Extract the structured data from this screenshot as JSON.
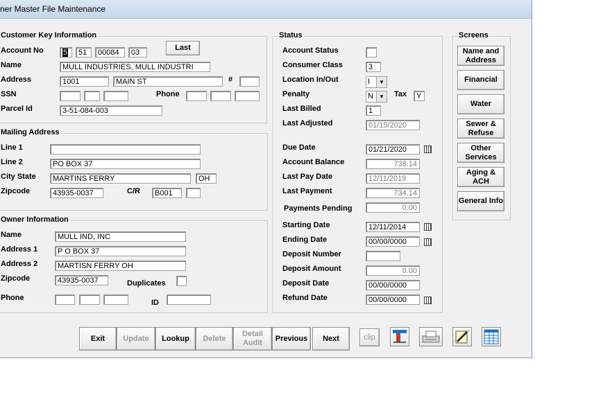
{
  "window": {
    "title": "ner Master File Maintenance"
  },
  "key_info": {
    "legend": "Customer Key Information",
    "account_no_label": "Account No",
    "account_no": [
      "5",
      "51",
      "00084",
      "03"
    ],
    "last_button": "Last",
    "name_label": "Name",
    "name": "MULL INDUSTRIES, MULL INDUSTRI",
    "address_label": "Address",
    "address_number": "1001",
    "address_street": "MAIN ST",
    "unit_label": "#",
    "unit": "",
    "ssn_label": "SSN",
    "phone_label": "Phone",
    "parcel_label": "Parcel Id",
    "parcel": "3-51-084-003"
  },
  "mailing": {
    "legend": "Mailing Address",
    "line1_label": "Line 1",
    "line1": "",
    "line2_label": "Line 2",
    "line2": "PO BOX 37",
    "city_label": "City State",
    "city": "MARTINS FERRY",
    "state": "OH",
    "zip_label": "Zipcode",
    "zip": "43935-0037",
    "cr_label": "C/R",
    "cr": "B001",
    "cr2": ""
  },
  "owner": {
    "legend": "Owner Information",
    "name_label": "Name",
    "name": "MULL IND, INC",
    "addr1_label": "Address 1",
    "addr1": "P O BOX 37",
    "addr2_label": "Address 2",
    "addr2": "MARTISN FERRY OH",
    "zip_label": "Zipcode",
    "zip": "43935-0037",
    "duplicates_label": "Duplicates",
    "phone_label": "Phone",
    "id_label": "ID"
  },
  "status": {
    "legend": "Status",
    "account_status_label": "Account Status",
    "account_status": "",
    "consumer_class_label": "Consumer Class",
    "consumer_class": "3",
    "location_label": "Location In/Out",
    "location": "I",
    "penalty_label": "Penalty",
    "penalty": "N",
    "tax_label": "Tax",
    "tax": "Y",
    "last_billed_label": "Last Billed",
    "last_billed": "1",
    "last_adjusted_label": "Last Adjusted",
    "last_adjusted": "01/15/2020",
    "due_date_label": "Due Date",
    "due_date": "01/21/2020",
    "balance_label": "Account Balance",
    "balance": "738.14",
    "last_pay_date_label": "Last Pay Date",
    "last_pay_date": "12/11/2019",
    "last_payment_label": "Last Payment",
    "last_payment": "734.14",
    "pending_label": "Payments Pending",
    "pending": "0.00",
    "starting_date_label": "Starting Date",
    "starting_date": "12/11/2014",
    "ending_date_label": "Ending Date",
    "ending_date": "00/00/0000",
    "deposit_number_label": "Deposit Number",
    "deposit_number": "",
    "deposit_amount_label": "Deposit Amount",
    "deposit_amount": "0.00",
    "deposit_date_label": "Deposit Date",
    "deposit_date": "00/00/0000",
    "refund_date_label": "Refund Date",
    "refund_date": "00/00/0000"
  },
  "screens": {
    "legend": "Screens",
    "items": [
      "Name and Address",
      "Financial",
      "Water",
      "Sewer & Refuse",
      "Other Services",
      "Aging & ACH",
      "General Info"
    ]
  },
  "toolbar": {
    "exit": "Exit",
    "update": "Update",
    "lookup": "Lookup",
    "delete": "Delete",
    "detail_audit": "Detail Audit",
    "previous": "Previous",
    "next": "Next",
    "clip": "clip"
  },
  "icons": {
    "accent": "#1e73be",
    "names": [
      "calendar-icon",
      "pin-icon",
      "printer-icon",
      "notepad-icon",
      "spreadsheet-icon"
    ]
  }
}
